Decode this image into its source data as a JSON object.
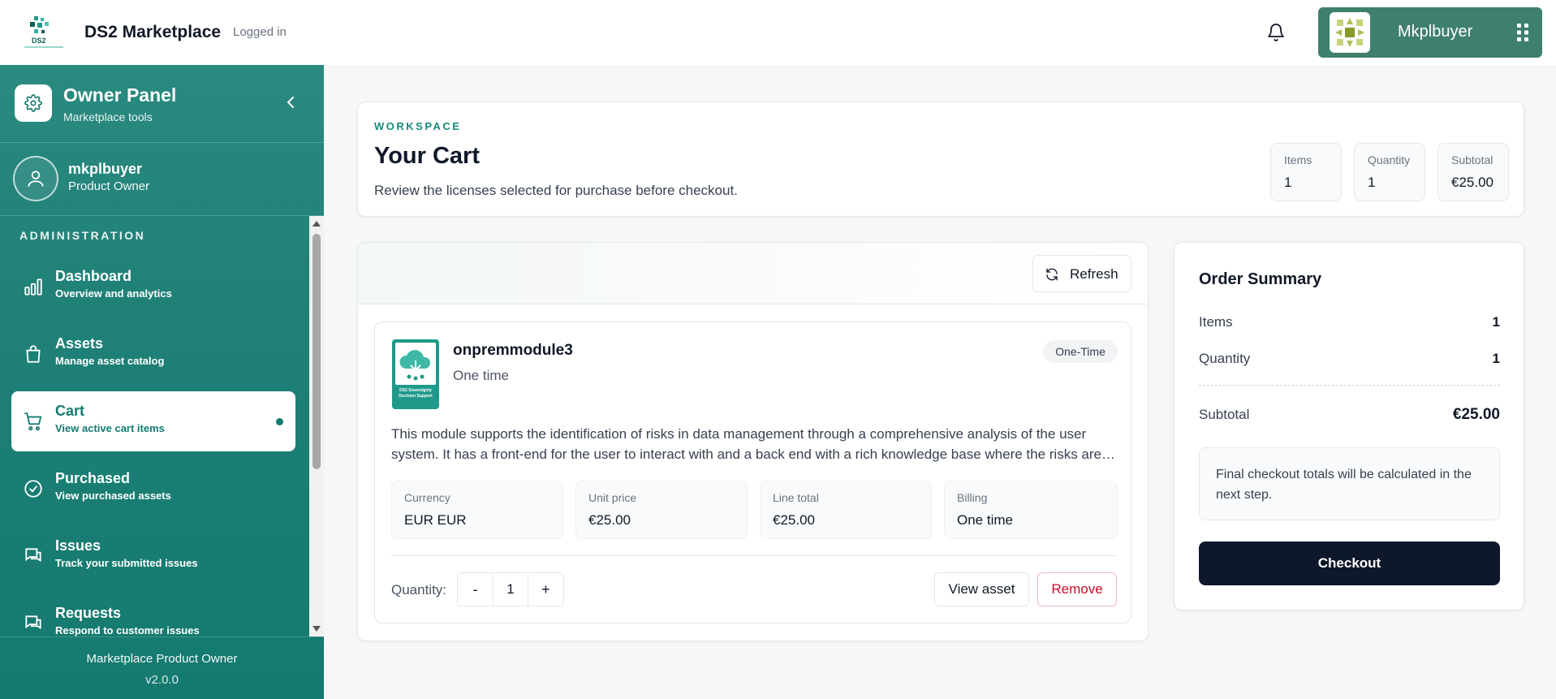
{
  "header": {
    "brand": "DS2 Marketplace",
    "status": "Logged in",
    "logo_text": "DS2",
    "notification_icon": "bell-icon",
    "user_name": "Mkplbuyer",
    "apps_icon": "grid-icon"
  },
  "sidebar": {
    "panel_title": "Owner Panel",
    "panel_subtitle": "Marketplace tools",
    "profile_name": "mkplbuyer",
    "profile_role": "Product Owner",
    "section_label": "ADMINISTRATION",
    "items": [
      {
        "label": "Dashboard",
        "sub": "Overview and analytics",
        "icon": "bar-chart-icon"
      },
      {
        "label": "Assets",
        "sub": "Manage asset catalog",
        "icon": "bag-icon"
      },
      {
        "label": "Cart",
        "sub": "View active cart items",
        "icon": "cart-icon",
        "active": true
      },
      {
        "label": "Purchased",
        "sub": "View purchased assets",
        "icon": "check-circle-icon"
      },
      {
        "label": "Issues",
        "sub": "Track your submitted issues",
        "icon": "chat-icon"
      },
      {
        "label": "Requests",
        "sub": "Respond to customer issues",
        "icon": "chat-icon"
      }
    ],
    "footer_title": "Marketplace Product Owner",
    "footer_version": "v2.0.0"
  },
  "workspace": {
    "eyebrow": "WORKSPACE",
    "title": "Your Cart",
    "description": "Review the licenses selected for purchase before checkout.",
    "stats": [
      {
        "label": "Items",
        "value": "1"
      },
      {
        "label": "Quantity",
        "value": "1"
      },
      {
        "label": "Subtotal",
        "value": "€25.00"
      }
    ]
  },
  "cart": {
    "refresh_label": "Refresh",
    "item": {
      "name": "onpremmodule3",
      "type": "One time",
      "badge": "One-Time",
      "thumb_caption": "DS2 Sovereignty Decision Support",
      "description": "This module supports the identification of risks in data management through a comprehensive analysis of the user system. It has a front-end for the user to interact with and a back end with a rich knowledge base where the risks are identified and mitigation measures are proposed.",
      "fields": [
        {
          "label": "Currency",
          "value": "EUR EUR"
        },
        {
          "label": "Unit price",
          "value": "€25.00"
        },
        {
          "label": "Line total",
          "value": "€25.00"
        },
        {
          "label": "Billing",
          "value": "One time"
        }
      ],
      "quantity_label": "Quantity:",
      "quantity": "1",
      "decrement": "-",
      "increment": "+",
      "view_label": "View asset",
      "remove_label": "Remove"
    }
  },
  "summary": {
    "title": "Order Summary",
    "items_label": "Items",
    "items_value": "1",
    "quantity_label": "Quantity",
    "quantity_value": "1",
    "subtotal_label": "Subtotal",
    "subtotal_value": "€25.00",
    "note": "Final checkout totals will be calculated in the next step.",
    "checkout_label": "Checkout"
  },
  "colors": {
    "accent": "#168a7b",
    "sidebar": "#1f8076",
    "user_chip": "#3f7f6e",
    "checkout": "#0f172a",
    "remove": "#c8102e"
  }
}
